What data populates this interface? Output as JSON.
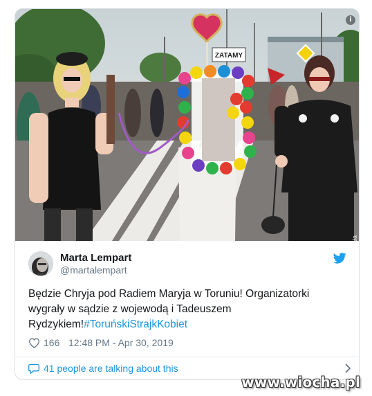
{
  "tweet": {
    "display_name": "Marta Lempart",
    "handle": "@martalempart",
    "text_main": "Będzie Chryja pod Radiem Maryja w Toruniu! Organizatorki wygrały w sądzie z wojewodą i Tadeuszem Rydzykiem!",
    "hashtag": "#ToruńskiStrajkKobiet",
    "likes": "166",
    "timestamp": "12:48 PM - Apr 30, 2019",
    "talking": "41 people are talking about this"
  },
  "photo": {
    "credit": "© Katarzyna Pierzchała",
    "banner_text": "ZATAMY",
    "info_glyph": "i"
  },
  "watermark": "www.wiocha.pl",
  "icons": {
    "bird": "twitter-bird-icon",
    "heart": "heart-icon",
    "bubble": "speech-bubble-icon",
    "chevron": "chevron-right-icon",
    "info": "info-icon"
  },
  "colors": {
    "accent": "#1b95e0",
    "muted": "#657786",
    "border": "#e6ecf0"
  }
}
